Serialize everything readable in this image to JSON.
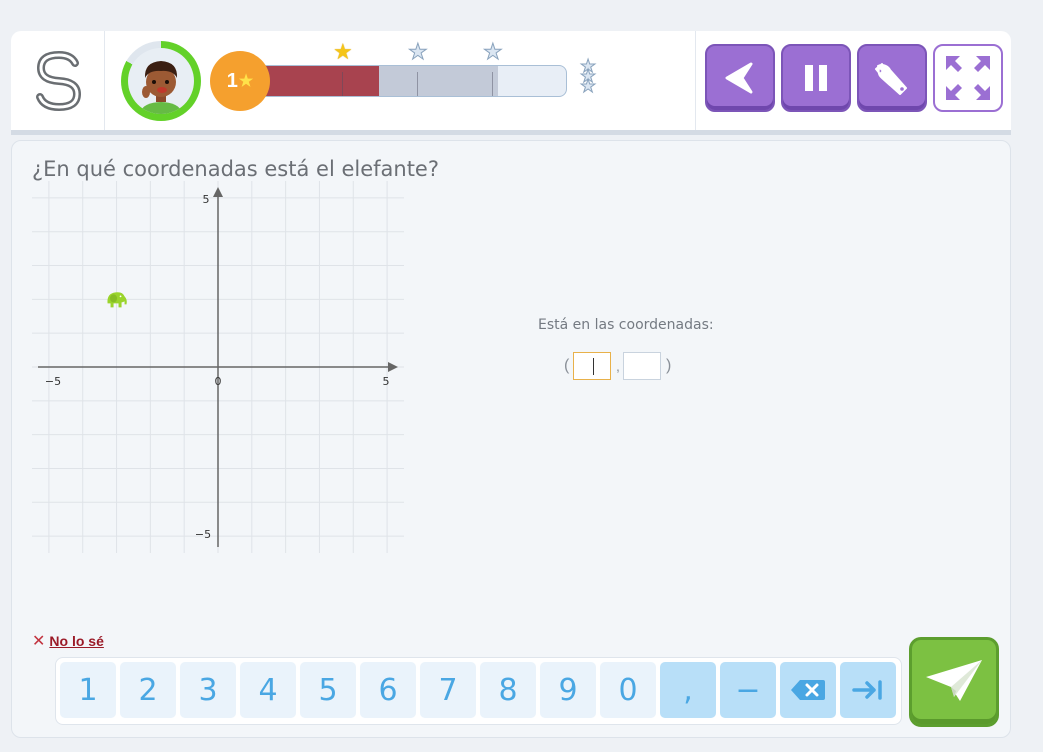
{
  "header": {
    "logo_letter": "S",
    "level": "1",
    "level_star": "★",
    "progress": {
      "filled": 0.39,
      "partial": 0.78
    },
    "milestone_stars": [
      "gold",
      "grey",
      "grey"
    ],
    "buttons": [
      "back",
      "pause",
      "tools",
      "fullscreen"
    ]
  },
  "question": {
    "text": "¿En qué coordenadas está el elefante?"
  },
  "plane": {
    "x_min": -5.5,
    "x_max": 5.5,
    "y_min": -5.5,
    "y_max": 5.5,
    "tick_labels": {
      "x_neg": "−5",
      "x_zero": "0",
      "x_pos": "5",
      "y_pos": "5",
      "y_neg": "−5"
    },
    "elephant": {
      "x": -3,
      "y": 2,
      "icon": "elephant-icon",
      "color": "#9ad42c"
    }
  },
  "answer": {
    "label": "Está en las coordenadas:",
    "open_paren": "(",
    "comma": ",",
    "close_paren": ")",
    "x_value": "",
    "y_value": ""
  },
  "dont_know": {
    "label": "No lo sé"
  },
  "keypad": {
    "keys": [
      "1",
      "2",
      "3",
      "4",
      "5",
      "6",
      "7",
      "8",
      "9",
      "0",
      ",",
      "−"
    ],
    "backspace_icon": "backspace-icon",
    "tab_icon": "tab-next-icon"
  },
  "send": {
    "icon": "paper-plane-icon"
  },
  "colors": {
    "accent_purple": "#9b6fd3",
    "send_green": "#7cc142",
    "progress_red": "#a8434f",
    "ring_green": "#63d129",
    "badge_orange": "#f5a02e"
  }
}
